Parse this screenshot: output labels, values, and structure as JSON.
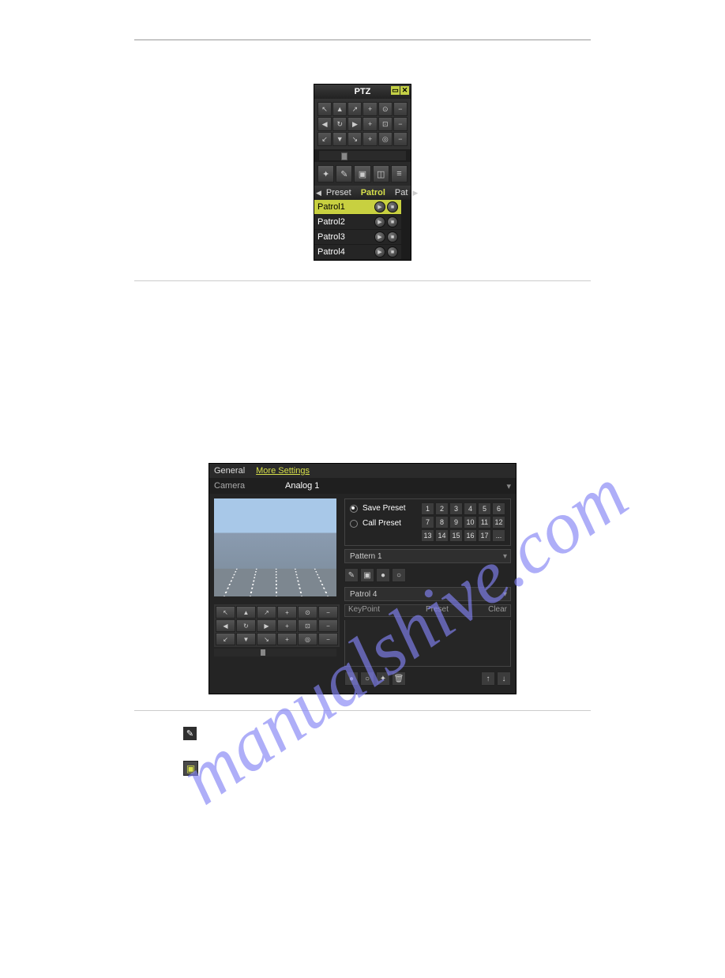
{
  "watermark_text": "manualshive.com",
  "ptz_panel": {
    "title": "PTZ",
    "minimize_icon": "minimize-icon",
    "close_icon": "close-icon",
    "direction_glyphs": [
      "↖",
      "▲",
      "↗",
      "+",
      "⊙",
      "−",
      "◀",
      "↻",
      "▶",
      "+",
      "⊡",
      "−",
      "↙",
      "▼",
      "↘",
      "+",
      "◎",
      "−"
    ],
    "action_icons": [
      "light-icon",
      "wiper-icon",
      "aux-icon",
      "focus-box-icon",
      "menu-icon"
    ],
    "tab_preset": "Preset",
    "tab_patrol": "Patrol",
    "tab_pattern": "Pat",
    "patrols": [
      "Patrol1",
      "Patrol2",
      "Patrol3",
      "Patrol4"
    ]
  },
  "settings_panel": {
    "tab_general": "General",
    "tab_more": "More Settings",
    "camera_label": "Camera",
    "camera_value": "Analog 1",
    "save_preset": "Save Preset",
    "call_preset": "Call Preset",
    "preset_numbers": [
      "1",
      "2",
      "3",
      "4",
      "5",
      "6",
      "7",
      "8",
      "9",
      "10",
      "11",
      "12",
      "13",
      "14",
      "15",
      "16",
      "17",
      "..."
    ],
    "pattern_label": "Pattern 1",
    "pattern_icons": [
      "pen-icon",
      "save-icon",
      "play-icon",
      "stop-icon"
    ],
    "patrol_label": "Patrol 4",
    "kp_col1": "KeyPoint",
    "kp_col2": "Preset",
    "kp_col3": "Clear",
    "bottom_left_icons": [
      "play-icon",
      "stop-icon",
      "plus-icon",
      "trash-icon"
    ],
    "bottom_right_icons": [
      "up-icon",
      "down-icon"
    ],
    "lower_ptz_glyphs": [
      "↖",
      "▲",
      "↗",
      "+",
      "⊙",
      "−",
      "◀",
      "↻",
      "▶",
      "+",
      "⊡",
      "−",
      "↙",
      "▼",
      "↘",
      "+",
      "◎",
      "−"
    ]
  },
  "standalone": {
    "pen_icon": "pen-icon",
    "save_icon": "save-icon"
  }
}
